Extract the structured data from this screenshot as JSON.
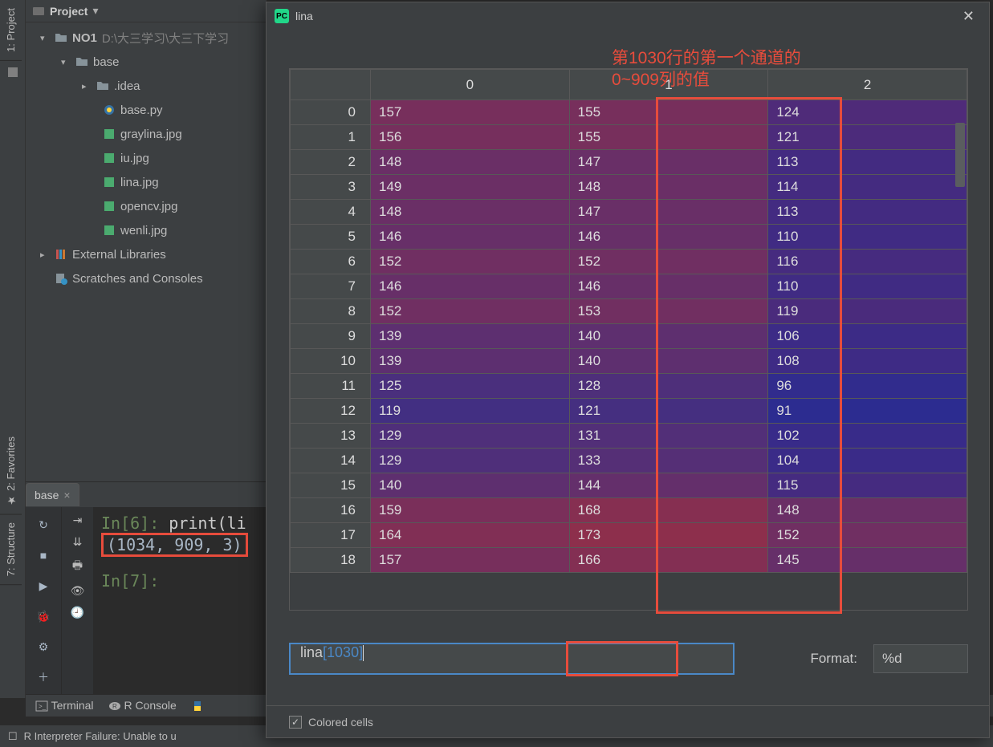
{
  "side_tabs": {
    "project": "1: Project",
    "favorites": "2: Favorites",
    "structure": "7: Structure"
  },
  "project": {
    "header": "Project",
    "root": {
      "name": "NO1",
      "path": "D:\\大三学习\\大三下学习"
    },
    "base_folder": "base",
    "idea_folder": ".idea",
    "files": [
      "base.py",
      "graylina.jpg",
      "iu.jpg",
      "lina.jpg",
      "opencv.jpg",
      "wenli.jpg"
    ],
    "external": "External Libraries",
    "scratches": "Scratches and Consoles"
  },
  "console": {
    "tab": "base",
    "in6_label": "In[6]:",
    "in6_code": "print(li",
    "output": "(1034, 909, 3)",
    "in7_label": "In[7]:"
  },
  "bottom": {
    "terminal": "Terminal",
    "rconsole": "R Console"
  },
  "status": "R Interpreter Failure: Unable to u",
  "dialog": {
    "title": "lina",
    "annotation_line1": "第1030行的第一个通道的",
    "annotation_line2": "0~909列的值",
    "columns": [
      "0",
      "1",
      "2"
    ],
    "rows": [
      {
        "i": "0",
        "c": [
          "157",
          "155",
          "124"
        ],
        "bg": [
          "#772f5c",
          "#772f5c",
          "#4f2b79"
        ]
      },
      {
        "i": "1",
        "c": [
          "156",
          "155",
          "121"
        ],
        "bg": [
          "#762f5d",
          "#772f5c",
          "#4c2b7b"
        ]
      },
      {
        "i": "2",
        "c": [
          "148",
          "147",
          "113"
        ],
        "bg": [
          "#6a2f66",
          "#692f67",
          "#432b81"
        ]
      },
      {
        "i": "3",
        "c": [
          "149",
          "148",
          "114"
        ],
        "bg": [
          "#6b2f65",
          "#6a2f66",
          "#442b80"
        ]
      },
      {
        "i": "4",
        "c": [
          "148",
          "147",
          "113"
        ],
        "bg": [
          "#6a2f66",
          "#692f67",
          "#432b81"
        ]
      },
      {
        "i": "5",
        "c": [
          "146",
          "146",
          "110"
        ],
        "bg": [
          "#672f68",
          "#672f68",
          "#402b83"
        ]
      },
      {
        "i": "6",
        "c": [
          "152",
          "152",
          "116"
        ],
        "bg": [
          "#702f62",
          "#702f62",
          "#462b7f"
        ]
      },
      {
        "i": "7",
        "c": [
          "146",
          "146",
          "110"
        ],
        "bg": [
          "#672f68",
          "#672f68",
          "#402b83"
        ]
      },
      {
        "i": "8",
        "c": [
          "152",
          "153",
          "119"
        ],
        "bg": [
          "#702f62",
          "#712f61",
          "#4a2b7c"
        ]
      },
      {
        "i": "9",
        "c": [
          "139",
          "140",
          "106"
        ],
        "bg": [
          "#5d2f70",
          "#5e2f6f",
          "#3c2b86"
        ]
      },
      {
        "i": "10",
        "c": [
          "139",
          "140",
          "108"
        ],
        "bg": [
          "#5d2f70",
          "#5e2f6f",
          "#3e2b85"
        ]
      },
      {
        "i": "11",
        "c": [
          "125",
          "128",
          "96"
        ],
        "bg": [
          "#4a2f7d",
          "#4e2f7a",
          "#312c8d"
        ]
      },
      {
        "i": "12",
        "c": [
          "119",
          "121",
          "91"
        ],
        "bg": [
          "#422f82",
          "#452f80",
          "#2c2c90"
        ]
      },
      {
        "i": "13",
        "c": [
          "129",
          "131",
          "102"
        ],
        "bg": [
          "#4f2f7a",
          "#522f78",
          "#382b89"
        ]
      },
      {
        "i": "14",
        "c": [
          "129",
          "133",
          "104"
        ],
        "bg": [
          "#4f2f7a",
          "#552f76",
          "#3a2b88"
        ]
      },
      {
        "i": "15",
        "c": [
          "140",
          "144",
          "115"
        ],
        "bg": [
          "#5e2f6f",
          "#642f6b",
          "#452b80"
        ]
      },
      {
        "i": "16",
        "c": [
          "159",
          "168",
          "148"
        ],
        "bg": [
          "#7a2f5a",
          "#862f51",
          "#6a2f66"
        ]
      },
      {
        "i": "17",
        "c": [
          "164",
          "173",
          "152"
        ],
        "bg": [
          "#812f55",
          "#8d2f4c",
          "#702f62"
        ]
      },
      {
        "i": "18",
        "c": [
          "157",
          "166",
          "145"
        ],
        "bg": [
          "#772f5c",
          "#832f53",
          "#662f69"
        ]
      }
    ],
    "expr_prefix": "lina",
    "expr_bracket": "[1030]",
    "format_label": "Format:",
    "format_value": "%d",
    "colored_cells": "Colored cells"
  }
}
